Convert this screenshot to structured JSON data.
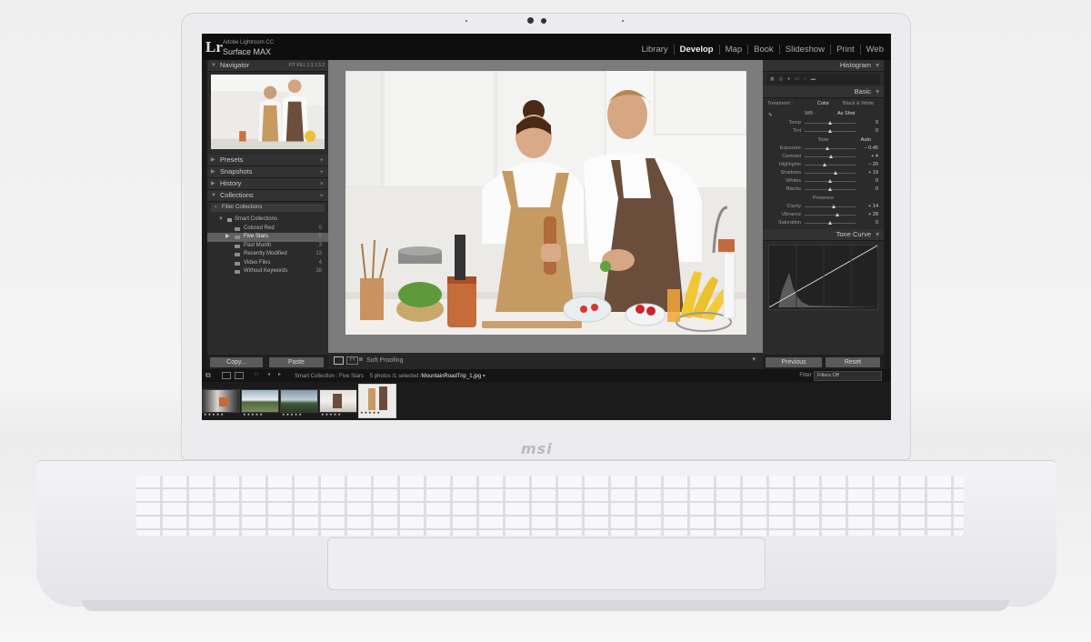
{
  "brand": {
    "logo_text": "msi"
  },
  "app": {
    "logo": "Lr",
    "identity_line1": "Adobe Lightroom CC",
    "identity_line2": "Surface MAX",
    "modules": [
      "Library",
      "Develop",
      "Map",
      "Book",
      "Slideshow",
      "Print",
      "Web"
    ],
    "active_module": "Develop"
  },
  "left_panel": {
    "navigator": {
      "title": "Navigator",
      "options": "FIT  FILL  1:1  1:3.2"
    },
    "sections": [
      "Presets",
      "Snapshots",
      "History",
      "Collections"
    ],
    "filter_label": "Filter Collections",
    "smart_collections_label": "Smart Collections",
    "collections": [
      {
        "name": "Colored Red",
        "count": "0"
      },
      {
        "name": "Five Stars",
        "count": "5",
        "selected": true
      },
      {
        "name": "Past Month",
        "count": "3"
      },
      {
        "name": "Recently Modified",
        "count": "13"
      },
      {
        "name": "Video Files",
        "count": "4"
      },
      {
        "name": "Without Keywords",
        "count": "38"
      }
    ],
    "copy_button": "Copy...",
    "paste_button": "Paste"
  },
  "toolbar": {
    "soft_proofing": "Soft Proofing"
  },
  "right_panel": {
    "histogram_title": "Histogram",
    "basic_title": "Basic",
    "treatment_label": "Treatment :",
    "treatment_color": "Color",
    "treatment_bw": "Black & White",
    "wb_label": "WB :",
    "wb_value": "As Shot",
    "tone_label": "Tone",
    "auto_label": "Auto",
    "presence_label": "Presence",
    "sliders_wb": [
      {
        "label": "Temp",
        "value": "0",
        "pos": 0.5
      },
      {
        "label": "Tint",
        "value": "0",
        "pos": 0.5
      }
    ],
    "sliders_tone": [
      {
        "label": "Exposure",
        "value": "– 0.45",
        "pos": 0.45
      },
      {
        "label": "Contrast",
        "value": "+ 4",
        "pos": 0.52
      },
      {
        "label": "Highlights",
        "value": "– 20",
        "pos": 0.4
      },
      {
        "label": "Shadows",
        "value": "+ 19",
        "pos": 0.6
      },
      {
        "label": "Whites",
        "value": "0",
        "pos": 0.5
      },
      {
        "label": "Blacks",
        "value": "0",
        "pos": 0.5
      }
    ],
    "sliders_presence": [
      {
        "label": "Clarity",
        "value": "+ 14",
        "pos": 0.57
      },
      {
        "label": "Vibrance",
        "value": "+ 28",
        "pos": 0.64
      },
      {
        "label": "Saturation",
        "value": "0",
        "pos": 0.5
      }
    ],
    "tone_curve_title": "Tone Curve",
    "previous_button": "Previous",
    "reset_button": "Reset"
  },
  "filmstrip": {
    "collection_path": "Smart Collection : Five Stars",
    "photo_count": "5 photos /1 selected /",
    "filename": "MountainRoadTrip_1.jpg",
    "filter_label": "Filter :",
    "filter_value": "Filters Off",
    "thumbs": [
      "kitchen-dark",
      "mountain",
      "mountain-road",
      "kitchen-light",
      "kitchen-couple"
    ],
    "stars": "★★★★★"
  }
}
